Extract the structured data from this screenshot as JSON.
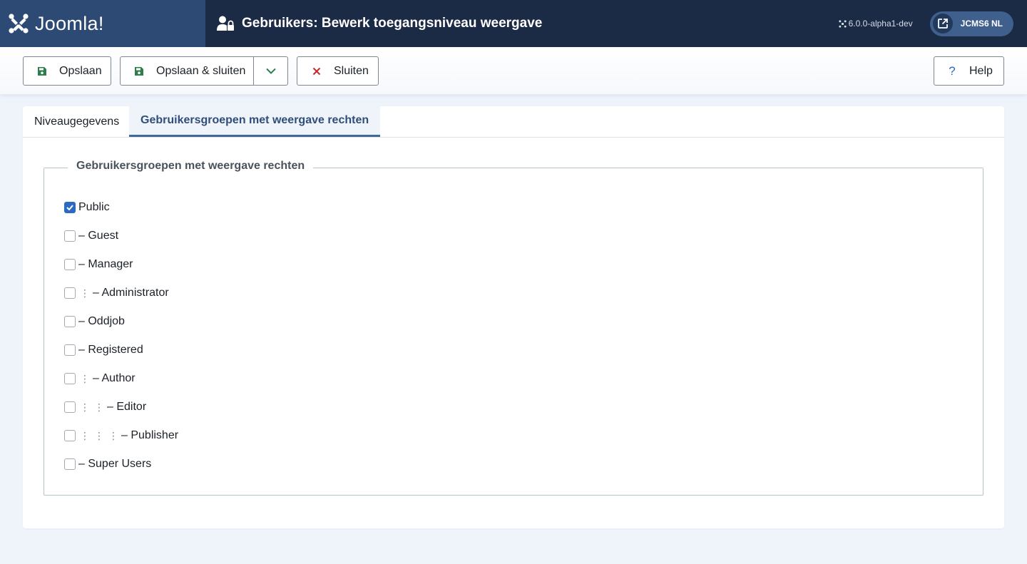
{
  "header": {
    "logo_text": "Joomla!",
    "title": "Gebruikers: Bewerk toegangsniveau weergave",
    "version": "6.0.0-alpha1-dev",
    "site_label": "JCMS6 NL"
  },
  "toolbar": {
    "save_label": "Opslaan",
    "save_close_label": "Opslaan & sluiten",
    "close_label": "Sluiten",
    "help_label": "Help"
  },
  "tabs": [
    {
      "label": "Niveaugegevens",
      "active": false
    },
    {
      "label": "Gebruikersgroepen met weergave rechten",
      "active": true
    }
  ],
  "fieldset": {
    "legend": "Gebruikersgroepen met weergave rechten",
    "groups": [
      {
        "label": "Public",
        "checked": true,
        "level": 0
      },
      {
        "label": "– Guest",
        "checked": false,
        "level": 1
      },
      {
        "label": "– Manager",
        "checked": false,
        "level": 1
      },
      {
        "label": "– Administrator",
        "checked": false,
        "level": 2
      },
      {
        "label": "– Oddjob",
        "checked": false,
        "level": 1
      },
      {
        "label": "– Registered",
        "checked": false,
        "level": 1
      },
      {
        "label": "– Author",
        "checked": false,
        "level": 2
      },
      {
        "label": "– Editor",
        "checked": false,
        "level": 3
      },
      {
        "label": "– Publisher",
        "checked": false,
        "level": 4
      },
      {
        "label": "– Super Users",
        "checked": false,
        "level": 1
      }
    ]
  },
  "colors": {
    "header_bg": "#1c2b45",
    "logo_bg": "#2c4a74",
    "accent": "#2c6ac2",
    "save_icon": "#2f7d4b",
    "close_icon": "#c52827",
    "help_icon": "#2c6ac2"
  }
}
